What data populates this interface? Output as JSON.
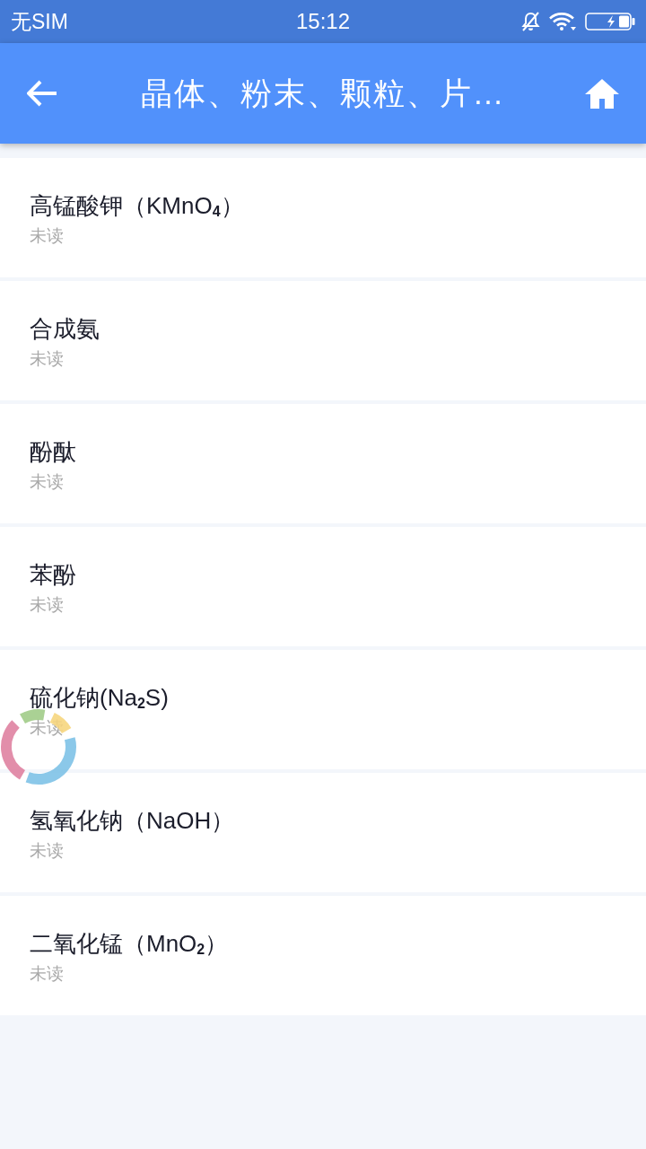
{
  "status_bar": {
    "carrier": "无SIM",
    "time": "15:12"
  },
  "app_bar": {
    "title": "晶体、粉末、颗粒、片…"
  },
  "items": [
    {
      "title": "高锰酸钾（KMnO$_{4}$）",
      "status": "未读"
    },
    {
      "title": "合成氨",
      "status": "未读"
    },
    {
      "title": "酚酞",
      "status": "未读"
    },
    {
      "title": "苯酚",
      "status": "未读"
    },
    {
      "title": "硫化钠(Na$_{2}$S)",
      "status": "未读"
    },
    {
      "title": "氢氧化钠（NaOH）",
      "status": "未读"
    },
    {
      "title": "二氧化锰（MnO$_{2}$）",
      "status": "未读"
    }
  ]
}
